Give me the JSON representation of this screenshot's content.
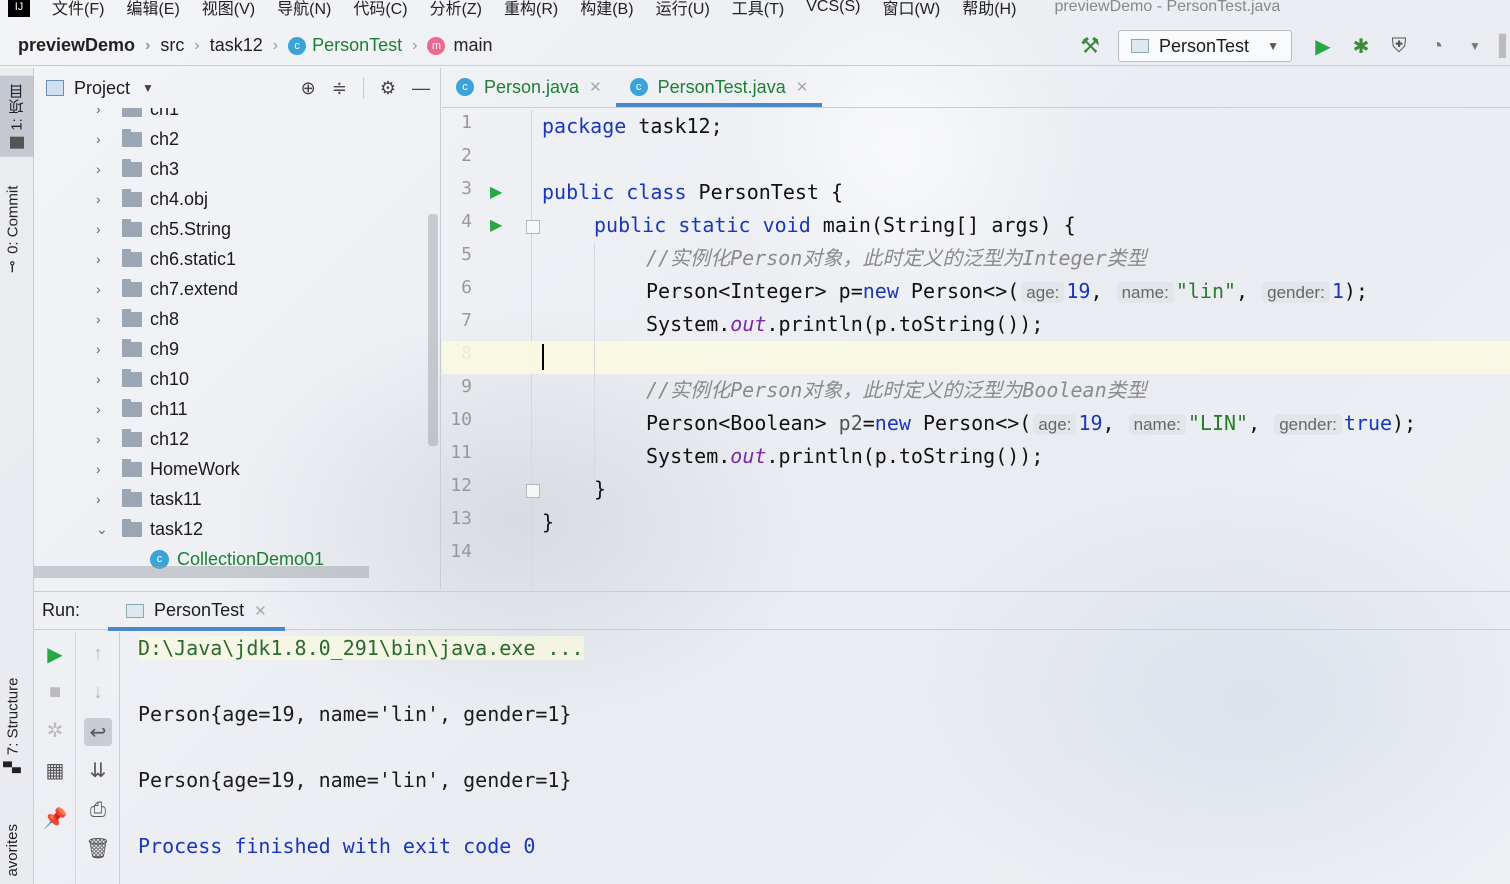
{
  "menubar": {
    "items": [
      "文件(F)",
      "编辑(E)",
      "视图(V)",
      "导航(N)",
      "代码(C)",
      "分析(Z)",
      "重构(R)",
      "构建(B)",
      "运行(U)",
      "工具(T)",
      "VCS(S)",
      "窗口(W)",
      "帮助(H)"
    ],
    "window_title": "previewDemo - PersonTest.java"
  },
  "breadcrumb": {
    "project": "previewDemo",
    "src": "src",
    "package": "task12",
    "class": "PersonTest",
    "method": "main"
  },
  "toolbar": {
    "run_config": "PersonTest",
    "icons": [
      "hammer-icon",
      "run-icon",
      "debug-icon",
      "coverage-icon",
      "profile-icon"
    ]
  },
  "left_stripe": {
    "project_tab": "1: 项目",
    "commit_tab": "0: Commit",
    "structure_tab": "7: Structure",
    "favorites_tab": "avorites"
  },
  "project_panel": {
    "title": "Project",
    "items": [
      {
        "label": "ch1",
        "expanded": false
      },
      {
        "label": "ch2",
        "expanded": false
      },
      {
        "label": "ch3",
        "expanded": false
      },
      {
        "label": "ch4.obj",
        "expanded": false
      },
      {
        "label": "ch5.String",
        "expanded": false
      },
      {
        "label": "ch6.static1",
        "expanded": false
      },
      {
        "label": "ch7.extend",
        "expanded": false
      },
      {
        "label": "ch8",
        "expanded": false
      },
      {
        "label": "ch9",
        "expanded": false
      },
      {
        "label": "ch10",
        "expanded": false
      },
      {
        "label": "ch11",
        "expanded": false
      },
      {
        "label": "ch12",
        "expanded": false
      },
      {
        "label": "HomeWork",
        "expanded": false
      },
      {
        "label": "task11",
        "expanded": false
      },
      {
        "label": "task12",
        "expanded": true
      }
    ],
    "child": "CollectionDemo01"
  },
  "editor": {
    "tabs": [
      {
        "label": "Person.java",
        "active": false
      },
      {
        "label": "PersonTest.java",
        "active": true
      }
    ],
    "line_numbers": [
      "1",
      "2",
      "3",
      "4",
      "5",
      "6",
      "7",
      "8",
      "9",
      "10",
      "11",
      "12",
      "13",
      "14"
    ],
    "code": {
      "l1_kw": "package",
      "l1_rest": " task12;",
      "l3_kw": "public class",
      "l3_rest": " PersonTest {",
      "l4_kw": "public static void",
      "l4_rest": " main(String[] args) {",
      "l5_comment": "//实例化Person对象，此时定义的泛型为Integer类型",
      "l6_a": "Person<Integer> p=",
      "l6_new": "new",
      "l6_b": " Person<>(",
      "l6_hint_age": "age:",
      "l6_age": "19",
      "l6_hint_name": "name:",
      "l6_name": "\"lin\"",
      "l6_hint_gender": "gender:",
      "l6_gender": "1",
      "l6_end": ");",
      "l7_a": "System.",
      "l7_out": "out",
      "l7_b": ".println(p.toString());",
      "l9_comment": "//实例化Person对象，此时定义的泛型为Boolean类型",
      "l10_a": "Person<Boolean> ",
      "l10_var": "p2",
      "l10_eq": "=",
      "l10_new": "new",
      "l10_b": " Person<>(",
      "l10_hint_age": "age:",
      "l10_age": "19",
      "l10_hint_name": "name:",
      "l10_name": "\"LIN\"",
      "l10_hint_gender": "gender:",
      "l10_gender": "true",
      "l10_end": ");",
      "l11_a": "System.",
      "l11_out": "out",
      "l11_b": ".println(p.toString());",
      "l12": "}",
      "l13": "}"
    }
  },
  "run_panel": {
    "label": "Run:",
    "tab": "PersonTest",
    "console": [
      "D:\\Java\\jdk1.8.0_291\\bin\\java.exe ...",
      "Person{age=19, name='lin', gender=1}",
      "Person{age=19, name='lin', gender=1}",
      "Process finished with exit code 0"
    ]
  },
  "colors": {
    "keyword": "#1a37b7",
    "string": "#2a7a2a",
    "comment": "#8a8a8a",
    "accent_tab": "#4a88c7",
    "run_green": "#28a745"
  }
}
